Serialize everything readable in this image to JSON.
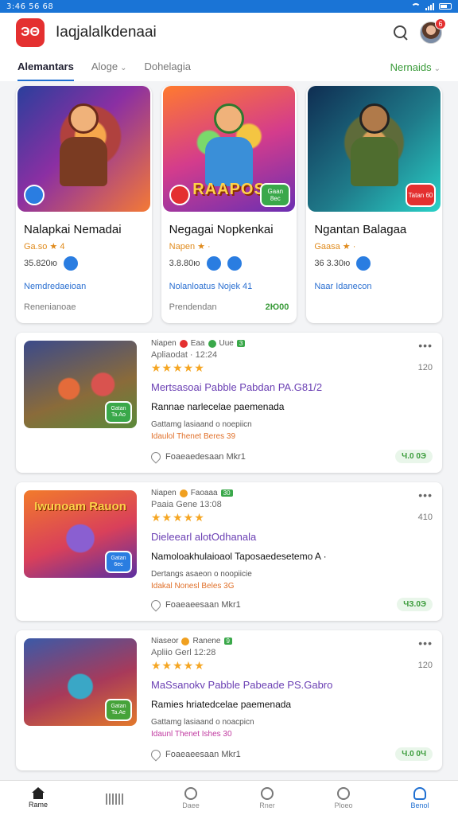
{
  "status_bar": {
    "time": "3:46 56 68"
  },
  "header": {
    "logo_text": "ЭΘ",
    "title": "Iaqjalalkdenaai",
    "notification_count": "6"
  },
  "tabs": [
    {
      "label": "Alemantars",
      "active": true
    },
    {
      "label": "Aloge",
      "dropdown": true
    },
    {
      "label": "Dohelagia"
    }
  ],
  "tab_right": {
    "label": "Nernaids"
  },
  "featured": [
    {
      "title": "Nalapkai Nemadai",
      "rating": "Ga.so ★ 4",
      "stats": "35.820ю",
      "link": "Nemdredaeioan",
      "foot": "Renenianoae",
      "price": "",
      "tag": ""
    },
    {
      "title": "Negagai Nopkenkai",
      "rating": "Napen ★ ·",
      "stats": "3.8.80ю",
      "link": "Nolanloatus Nojek 41",
      "foot": "Prendendan",
      "price": "2Ю00",
      "tag": "Gaan 8ec",
      "word": "RAAPOS"
    },
    {
      "title": "Ngantan Balagaa",
      "rating": "Gaasa ★ ·",
      "stats": "36 3.30ю",
      "link": "Naar Idanecon",
      "foot": "",
      "price": "",
      "tag": "Tatan 60"
    }
  ],
  "list": [
    {
      "meta1": "Niapen",
      "meta2": "Eaa",
      "meta3": "Uue",
      "pill": "3",
      "date": "Apliaodat · 12:24",
      "stars": "★★★★★",
      "count": "120",
      "title": "Mertsasoai Pabble Pabdan PA.G81/2",
      "sub": "Rannae narlecelae paemenada",
      "desc": "Gattamg lasiaand o noepiicn",
      "highlight": "Idaulol Thenet Beres 39",
      "likes": "Foaeaedesaan Mkr1",
      "price": "Ч.0 0Э",
      "tag": "Gatan Ta.Ao"
    },
    {
      "meta1": "Niapen",
      "meta2": "Faoaaa",
      "meta3": "",
      "pill": "30",
      "date": "Paaia Gene 13:08",
      "stars": "★★★★★",
      "count": "410",
      "title": "Dieleearl alotOdhanala",
      "sub": "Namoloakhulaioaol Taposaedesetemo A ·",
      "desc": "Dertangs asaeon o noopiicie",
      "highlight": "Idakal Nonesl Beles 3G",
      "likes": "Foaeaeesaan Mkr1",
      "price": "ЧЗ.0Э",
      "tag": "Gatan 6ec",
      "word": "Iwunoam Rauon"
    },
    {
      "meta1": "Niaseor",
      "meta2": "Ranene",
      "meta3": "",
      "pill": "9",
      "date": "Apliio Gerl 12:28",
      "stars": "★★★★★",
      "count": "120",
      "title": "MaSsanokv Pabble Pabeade PS.Gabro",
      "sub": "Ramies hriatedcelae paemenada",
      "desc": "Gattamg lasiaand o noacpicn",
      "highlight": "Idaunl Thenet Ishes 30",
      "likes": "Foaeaeesaan Mkr1",
      "price": "Ч.0 0Ч",
      "tag": "Gatan Ta.Ae"
    }
  ],
  "bottom_nav": [
    {
      "label": "Rame",
      "icon": "home-icon",
      "active": true
    },
    {
      "label": "",
      "icon": "barcode-icon"
    },
    {
      "label": "Daee",
      "icon": "circle-icon"
    },
    {
      "label": "Rner",
      "icon": "search-icon"
    },
    {
      "label": "Ploeo",
      "icon": "gamepad-icon"
    },
    {
      "label": "Benol",
      "icon": "user-icon"
    }
  ],
  "colors": {
    "primary": "#1f6fd1",
    "status_bar": "#1a74d6",
    "brand_red": "#e43030",
    "price_green": "#3a9b3a",
    "title_purple": "#6a3fb3"
  }
}
